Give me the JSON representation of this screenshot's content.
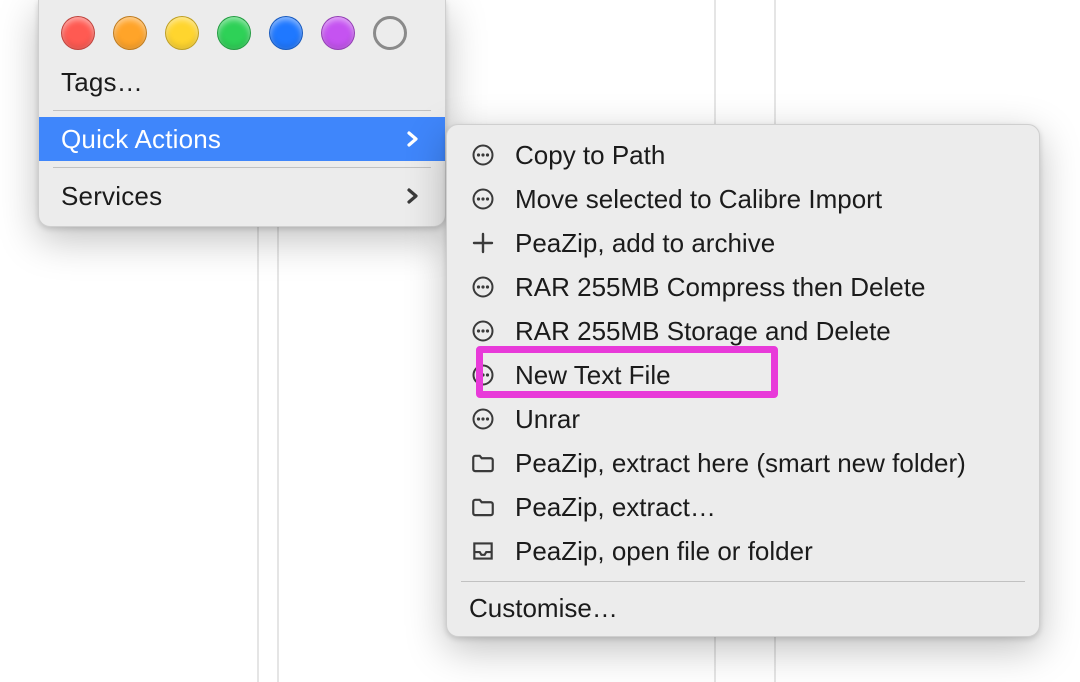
{
  "tags": {
    "label": "Tags…",
    "colors": [
      "#ff5a52",
      "#ffa429",
      "#ffd52e",
      "#2ed157",
      "#1f78ff",
      "#c553f1"
    ],
    "empty": true
  },
  "primary_menu": {
    "items": [
      {
        "id": "quick-actions",
        "label": "Quick Actions",
        "submenu": true,
        "highlighted": true
      },
      {
        "id": "services",
        "label": "Services",
        "submenu": true,
        "highlighted": false
      }
    ]
  },
  "submenu": {
    "items": [
      {
        "icon": "ellipsis",
        "label": "Copy to Path"
      },
      {
        "icon": "ellipsis",
        "label": "Move selected to Calibre Import"
      },
      {
        "icon": "plus",
        "label": "PeaZip, add to archive"
      },
      {
        "icon": "ellipsis",
        "label": "RAR 255MB Compress then Delete"
      },
      {
        "icon": "ellipsis",
        "label": "RAR 255MB Storage and Delete"
      },
      {
        "icon": "ellipsis",
        "label": "New Text File"
      },
      {
        "icon": "ellipsis",
        "label": "Unrar"
      },
      {
        "icon": "folder",
        "label": "PeaZip, extract here (smart new folder)"
      },
      {
        "icon": "folder",
        "label": "PeaZip, extract…"
      },
      {
        "icon": "tray",
        "label": "PeaZip, open file or folder"
      }
    ],
    "footer": "Customise…"
  },
  "annotation": {
    "selected_index": 5
  },
  "colors": {
    "menu_bg": "#ececec",
    "highlight": "#3f86fb",
    "annotation": "#e83ad9"
  }
}
